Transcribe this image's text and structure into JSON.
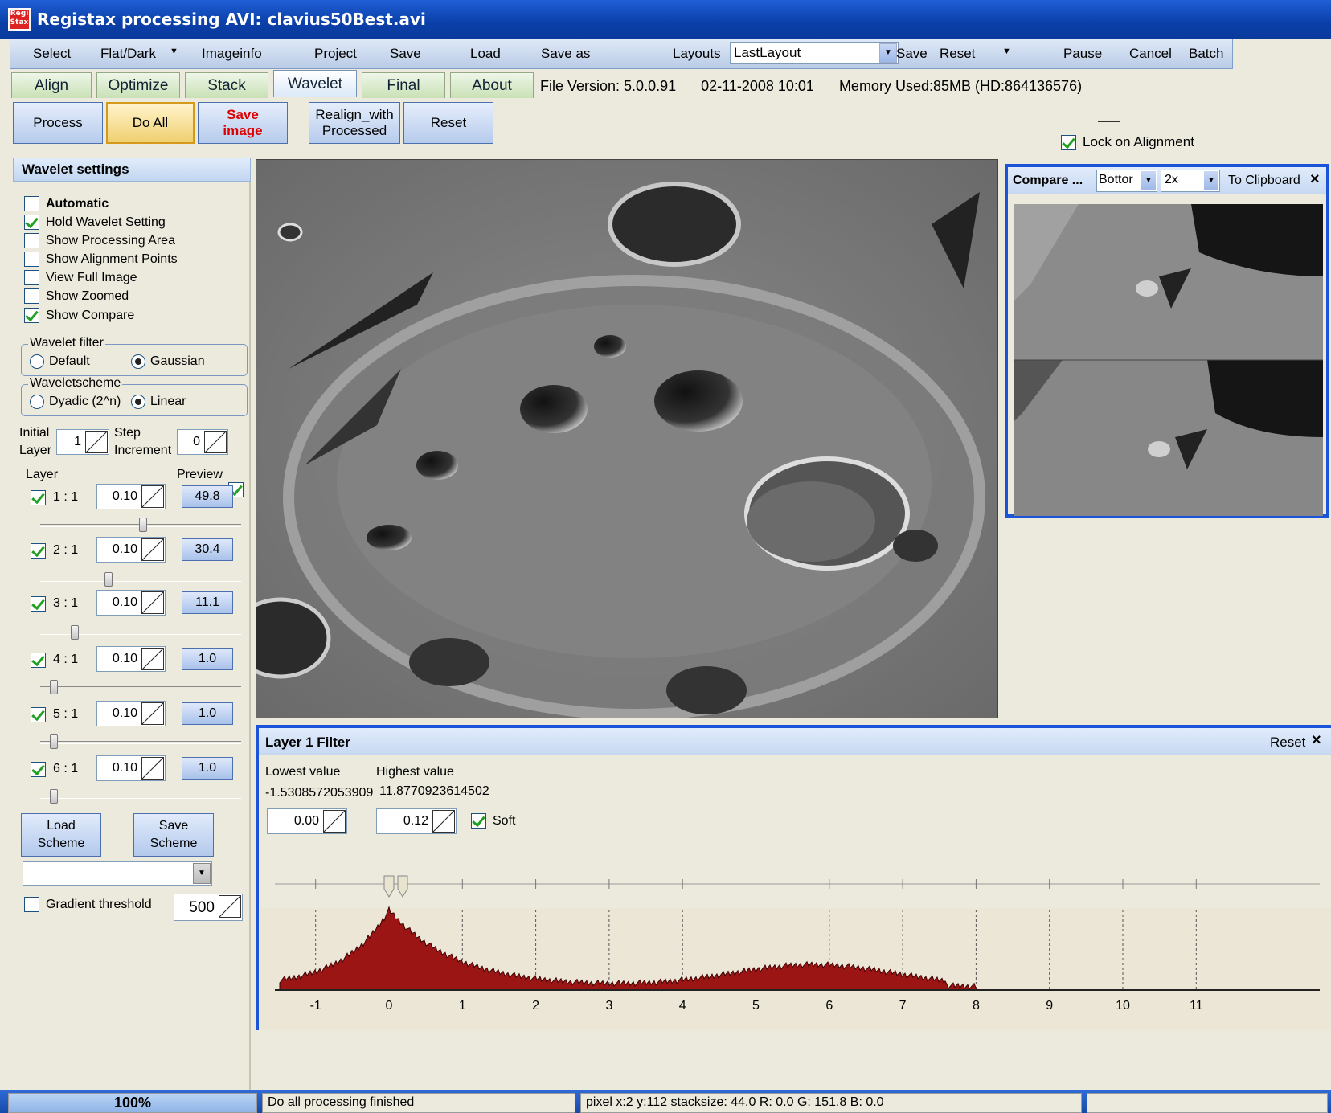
{
  "window": {
    "title": "Registax processing AVI: clavius50Best.avi",
    "icon_text": "Regi Stax"
  },
  "menu": {
    "items": [
      "Select",
      "Flat/Dark",
      "Imageinfo",
      "Project",
      "Save",
      "Load",
      "Save as",
      "Layouts",
      "Save",
      "Reset",
      "Pause",
      "Cancel",
      "Batch"
    ],
    "layout_value": "LastLayout"
  },
  "tabs": [
    "Align",
    "Optimize",
    "Stack",
    "Wavelet",
    "Final",
    "About"
  ],
  "fileinfo": {
    "version": "File Version: 5.0.0.91",
    "date": "02-11-2008 10:01",
    "memory": "Memory Used:85MB  (HD:864136576)"
  },
  "toolbar": {
    "process": "Process",
    "doall": "Do All",
    "save_image_1": "Save",
    "save_image_2": "image",
    "realign_1": "Realign_with",
    "realign_2": "Processed",
    "reset": "Reset",
    "lock_alignment": "Lock on Alignment"
  },
  "wavelet": {
    "title": "Wavelet settings",
    "options": [
      {
        "label": "Automatic",
        "checked": false
      },
      {
        "label": "Hold Wavelet Setting",
        "checked": true
      },
      {
        "label": "Show Processing Area",
        "checked": false
      },
      {
        "label": "Show Alignment Points",
        "checked": false
      },
      {
        "label": "View Full Image",
        "checked": false
      },
      {
        "label": "Show Zoomed",
        "checked": false
      },
      {
        "label": "Show Compare",
        "checked": true
      }
    ],
    "filter_title": "Wavelet filter",
    "filter_default": "Default",
    "filter_gaussian": "Gaussian",
    "scheme_title": "Waveletscheme",
    "scheme_dyadic": "Dyadic (2^n)",
    "scheme_linear": "Linear",
    "initial": "Initial",
    "layer_word": "Layer",
    "initial_value": "1",
    "step": "Step",
    "increment": "Increment",
    "step_value": "0",
    "col_layer": "Layer",
    "col_preview": "Preview",
    "layers": [
      {
        "label": "1 : 1",
        "value": "0.10",
        "preview": "49.8",
        "slider": 0.52
      },
      {
        "label": "2 : 1",
        "value": "0.10",
        "preview": "30.4",
        "slider": 0.34
      },
      {
        "label": "3 : 1",
        "value": "0.10",
        "preview": "11.1",
        "slider": 0.16
      },
      {
        "label": "4 : 1",
        "value": "0.10",
        "preview": "1.0",
        "slider": 0.05
      },
      {
        "label": "5 : 1",
        "value": "0.10",
        "preview": "1.0",
        "slider": 0.05
      },
      {
        "label": "6 : 1",
        "value": "0.10",
        "preview": "1.0",
        "slider": 0.05
      }
    ],
    "load_1": "Load",
    "load_2": "Scheme",
    "save_1": "Save",
    "save_2": "Scheme",
    "gradient_label": "Gradient threshold",
    "gradient_value": "500"
  },
  "compare": {
    "title": "Compare ...",
    "position": "Bottor",
    "zoom": "2x",
    "clipboard": "To Clipboard"
  },
  "filter": {
    "title": "Layer 1 Filter",
    "reset": "Reset",
    "lowest_label": "Lowest value",
    "highest_label": "Highest value",
    "lowest": "-1.5308572053909",
    "highest": "11.8770923614502",
    "low_input": "0.00",
    "high_input": "0.12",
    "soft": "Soft",
    "xticks": [
      "-1",
      "0",
      "1",
      "2",
      "3",
      "4",
      "5",
      "6",
      "7",
      "8",
      "9",
      "10",
      "11"
    ]
  },
  "status": {
    "percent": "100%",
    "message": "Do  all processing finished",
    "pixel": "pixel x:2 y:112 stacksize: 44.0 R: 0.0 G: 151.8 B: 0.0"
  }
}
